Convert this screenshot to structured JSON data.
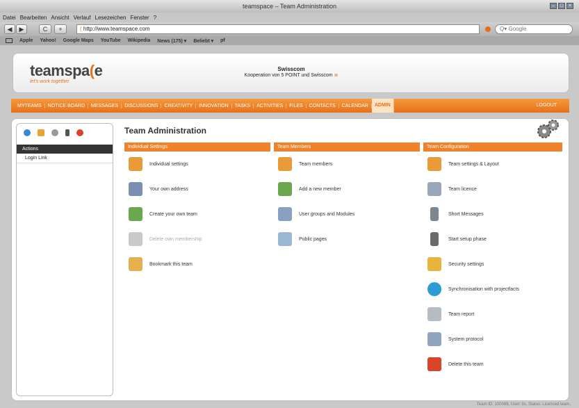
{
  "window": {
    "title": "teamspace – Team Administration"
  },
  "menu": [
    "Datei",
    "Bearbeiten",
    "Ansicht",
    "Verlauf",
    "Lesezeichen",
    "Fenster",
    "?"
  ],
  "browser": {
    "url": "http://www.teamspace.com",
    "search_placeholder": "Google",
    "buttons": {
      "back": "◀",
      "forward": "▶",
      "reload": "C",
      "add": "+"
    }
  },
  "bookmarks": [
    "Apple",
    "Yahoo!",
    "Google Maps",
    "YouTube",
    "Wikipedia",
    "News (175) ▾",
    "Beliebt ▾",
    "pf"
  ],
  "header": {
    "logo_text_1": "teamspa",
    "logo_text_2": "e",
    "tagline": "let's work together",
    "partner_name": "Swisscom",
    "partner_sub": "Kooperation von 5 POINT und Swisscom"
  },
  "nav": {
    "items": [
      "MYTEAMS",
      "NOTICE BOARD",
      "MESSAGES",
      "DISCUSSIONS",
      "CREATIVITY",
      "INNOVATION",
      "TASKS",
      "ACTIVITIES",
      "FILES",
      "CONTACTS",
      "CALENDAR",
      "ADMIN"
    ],
    "active": "ADMIN",
    "logout": "LOGOUT"
  },
  "sidebar": {
    "heading": "Actions",
    "links": [
      "Login Link"
    ]
  },
  "page_title": "Team Administration",
  "columns": [
    {
      "heading": "Individual Settings",
      "items": [
        {
          "label": "Individual settings",
          "icon": "person-gear-icon",
          "color": "#e99b3a"
        },
        {
          "label": "Your own address",
          "icon": "address-card-icon",
          "color": "#7a8fb3"
        },
        {
          "label": "Create your own team",
          "icon": "add-team-icon",
          "color": "#6aa84f"
        },
        {
          "label": "Delete own membership",
          "icon": "delete-membership-icon",
          "color": "#c9c9c9",
          "disabled": true
        },
        {
          "label": "Bookmark this team",
          "icon": "bookmark-icon",
          "color": "#e6b04e"
        }
      ]
    },
    {
      "heading": "Team Members",
      "items": [
        {
          "label": "Team members",
          "icon": "team-members-icon",
          "color": "#e99b3a"
        },
        {
          "label": "Add a new member",
          "icon": "add-member-icon",
          "color": "#6aa84f"
        },
        {
          "label": "User groups and Modules",
          "icon": "user-groups-icon",
          "color": "#8aa0c0"
        },
        {
          "label": "Public pages",
          "icon": "public-pages-icon",
          "color": "#9bb7d6"
        }
      ]
    },
    {
      "heading": "Team Configuration",
      "items": [
        {
          "label": "Team settings & Layout",
          "icon": "team-layout-icon",
          "color": "#e99b3a"
        },
        {
          "label": "Team licence",
          "icon": "licence-icon",
          "color": "#9aa7b8"
        },
        {
          "label": "Short Messages",
          "icon": "phone-icon",
          "color": "#7c8792"
        },
        {
          "label": "Start setup phase",
          "icon": "traffic-light-icon",
          "color": "#6a6a6a"
        },
        {
          "label": "Security settings",
          "icon": "lock-icon",
          "color": "#e8b43c"
        },
        {
          "label": "Synchronisation with projectfacts",
          "icon": "sync-icon",
          "color": "#2f9bd4"
        },
        {
          "label": "Team report",
          "icon": "report-icon",
          "color": "#b6bcc4"
        },
        {
          "label": "System protocol",
          "icon": "protocol-icon",
          "color": "#8fa4bf"
        },
        {
          "label": "Delete this team",
          "icon": "delete-team-icon",
          "color": "#d9442a"
        }
      ]
    }
  ],
  "footer": "Team ID: 100069, User: lis, Status: Licenced team,"
}
